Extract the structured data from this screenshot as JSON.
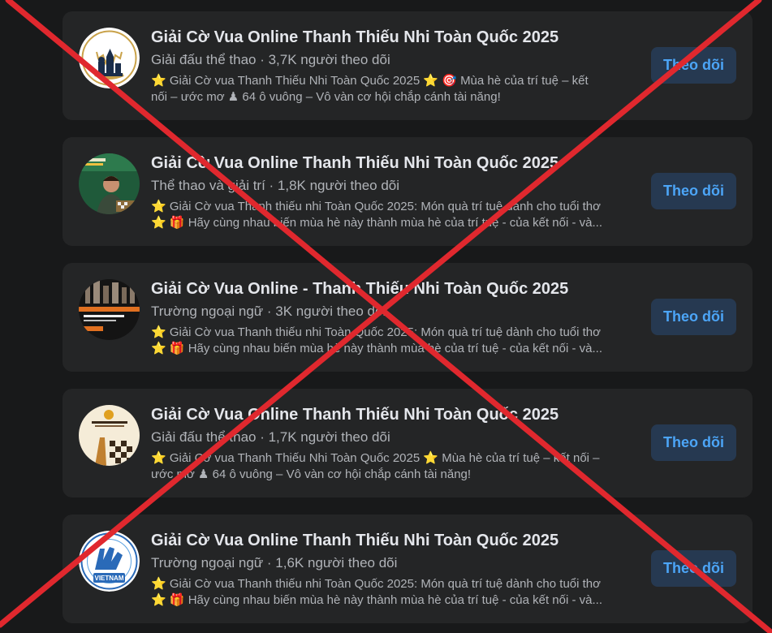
{
  "pages": [
    {
      "title": "Giải Cờ Vua Online Thanh Thiếu Nhi Toàn Quốc 2025",
      "meta": "Giải đấu thể thao · 3,7K người theo dõi",
      "desc_line1": "⭐ Giải Cờ vua Thanh Thiếu Nhi Toàn Quốc 2025 ⭐ 🎯 Mùa hè của trí tuệ – kết",
      "desc_line2": "nối – ước mơ ♟ 64 ô vuông – Vô vàn cơ hội chắp cánh tài năng!",
      "follow_label": "Theo dõi",
      "avatar_icon": "chess-logo-icon"
    },
    {
      "title": "Giải Cờ Vua Online Thanh Thiếu Nhi Toàn Quốc 2025",
      "meta": "Thể thao và giải trí · 1,8K người theo dõi",
      "desc_line1": "⭐ Giải Cờ vua Thanh thiếu nhi Toàn Quốc 2025: Món quà trí tuệ dành cho tuổi thơ",
      "desc_line2": "⭐ 🎁 Hãy cùng nhau biến mùa hè này thành mùa hè của trí tuệ - của kết nối - và...",
      "follow_label": "Theo dõi",
      "avatar_icon": "child-photo-icon"
    },
    {
      "title": "Giải Cờ Vua Online - Thanh Thiếu Nhi Toàn Quốc 2025",
      "meta": "Trường ngoại ngữ · 3K người theo dõi",
      "desc_line1": "⭐ Giải Cờ vua Thanh thiếu nhi Toàn Quốc 2025: Món quà trí tuệ dành cho tuổi thơ",
      "desc_line2": "⭐ 🎁 Hãy cùng nhau biến mùa hè này thành mùa hè của trí tuệ - của kết nối - và...",
      "follow_label": "Theo dõi",
      "avatar_icon": "chess-poster-icon"
    },
    {
      "title": "Giải Cờ Vua Online Thanh Thiếu Nhi Toàn Quốc 2025",
      "meta": "Giải đấu thể thao · 1,7K người theo dõi",
      "desc_line1": "⭐ Giải Cờ vua Thanh Thiếu Nhi Toàn Quốc 2025 ⭐ Mùa hè của trí tuệ – kết nối –",
      "desc_line2": "ước mơ ♟ 64 ô vuông – Vô vàn cơ hội chắp cánh tài năng!",
      "follow_label": "Theo dõi",
      "avatar_icon": "chessboard-poster-icon"
    },
    {
      "title": "Giải Cờ Vua Online Thanh Thiếu Nhi Toàn Quốc 2025",
      "meta": "Trường ngoại ngữ · 1,6K người theo dõi",
      "desc_line1": "⭐ Giải Cờ vua Thanh thiếu nhi Toàn Quốc 2025: Món quà trí tuệ dành cho tuổi thơ",
      "desc_line2": "⭐ 🎁 Hãy cùng nhau biến mùa hè này thành mùa hè của trí tuệ - của kết nối - và...",
      "follow_label": "Theo dõi",
      "avatar_icon": "vietnam-chess-logo-icon",
      "avatar_text": "VIETNAM"
    }
  ],
  "colors": {
    "background": "#18191a",
    "card": "#242526",
    "title": "#e4e6eb",
    "secondary": "#b0b3b8",
    "button_bg": "#263951",
    "button_text": "#4ca5f7",
    "cross": "#e0282e"
  },
  "overlay_icon": "red-x-cross-icon"
}
